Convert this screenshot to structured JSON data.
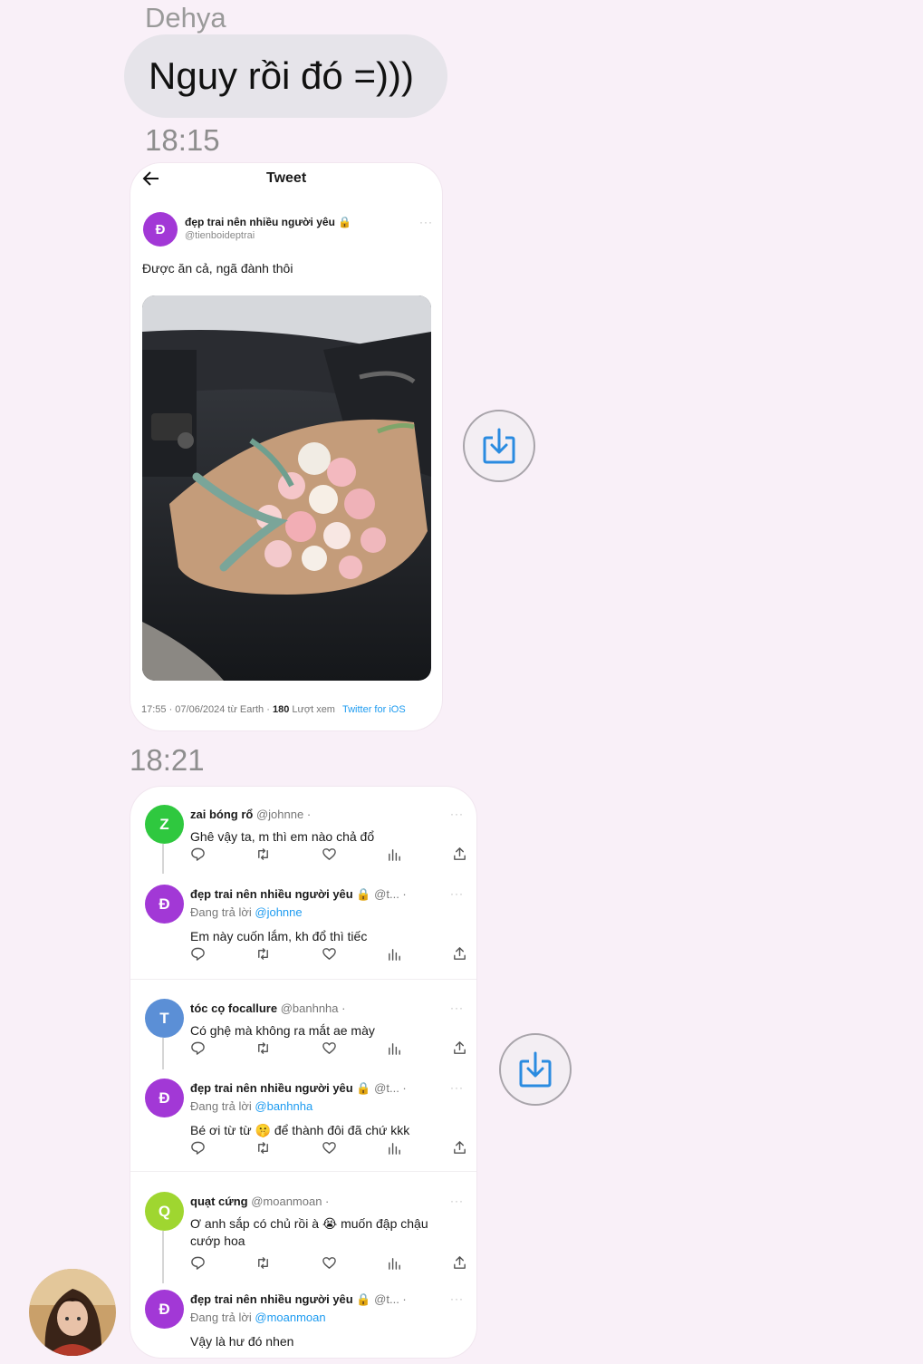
{
  "chat": {
    "sender_name": "Dehya",
    "message_text": "Nguy rồi đó =)))",
    "time_1": "18:15",
    "time_2": "18:21"
  },
  "tweet": {
    "back_icon": "arrow-left-icon",
    "title": "Tweet",
    "avatar_letter": "Đ",
    "author_name": "đẹp trai nên nhiều người yêu 🔒",
    "author_handle": "@tienboideptrai",
    "more": "···",
    "text": "Được ăn cả, ngã đành thôi",
    "meta_prefix": "17:55 · 07/06/2024 từ Earth · ",
    "views": "180",
    "views_label": " Lượt xem",
    "client": "Twitter for iOS"
  },
  "replies": [
    {
      "avatar_letter": "Z",
      "color": "#2fc83f",
      "name": "zai bóng rổ",
      "handle": "@johnne ·",
      "text": "Ghê vậy ta, m thì em nào chả đổ",
      "sub_prefix": "",
      "sub_mention": ""
    },
    {
      "avatar_letter": "Đ",
      "color": "#a238d6",
      "name": "đẹp trai nên nhiều người yêu 🔒",
      "handle": "@t... ·",
      "sub_prefix": "Đang trả lời ",
      "sub_mention": "@johnne",
      "text": "Em này cuốn lắm, kh đổ thì tiếc"
    },
    {
      "avatar_letter": "T",
      "color": "#5b8fd6",
      "name": "tóc cọ focallure",
      "handle": "@banhnha ·",
      "text": "Có ghệ mà không ra mắt ae mày",
      "sub_prefix": "",
      "sub_mention": ""
    },
    {
      "avatar_letter": "Đ",
      "color": "#a238d6",
      "name": "đẹp trai nên nhiều người yêu 🔒",
      "handle": "@t... ·",
      "sub_prefix": "Đang trả lời ",
      "sub_mention": "@banhnha",
      "text": "Bé ơi từ từ 🤫 để thành đôi đã chứ kkk"
    },
    {
      "avatar_letter": "Q",
      "color": "#9fd630",
      "name": "quạt cứng",
      "handle": "@moanmoan ·",
      "text": "Ơ anh sắp có chủ rồi à 😭 muốn đập chậu cướp hoa",
      "sub_prefix": "",
      "sub_mention": ""
    },
    {
      "avatar_letter": "Đ",
      "color": "#a238d6",
      "name": "đẹp trai nên nhiều người yêu 🔒",
      "handle": "@t... ·",
      "sub_prefix": "Đang trả lời ",
      "sub_mention": "@moanmoan",
      "text": "Vậy là hư đó nhen"
    }
  ],
  "icons": {
    "reply": "reply-icon",
    "retweet": "retweet-icon",
    "like": "heart-icon",
    "views": "views-icon",
    "share": "share-icon",
    "download": "download-icon"
  },
  "colors": {
    "background": "#f9f0f8",
    "bubble": "#e6e4ea",
    "twitter_blue": "#1d9bf0",
    "download_icon": "#2a8be0"
  }
}
